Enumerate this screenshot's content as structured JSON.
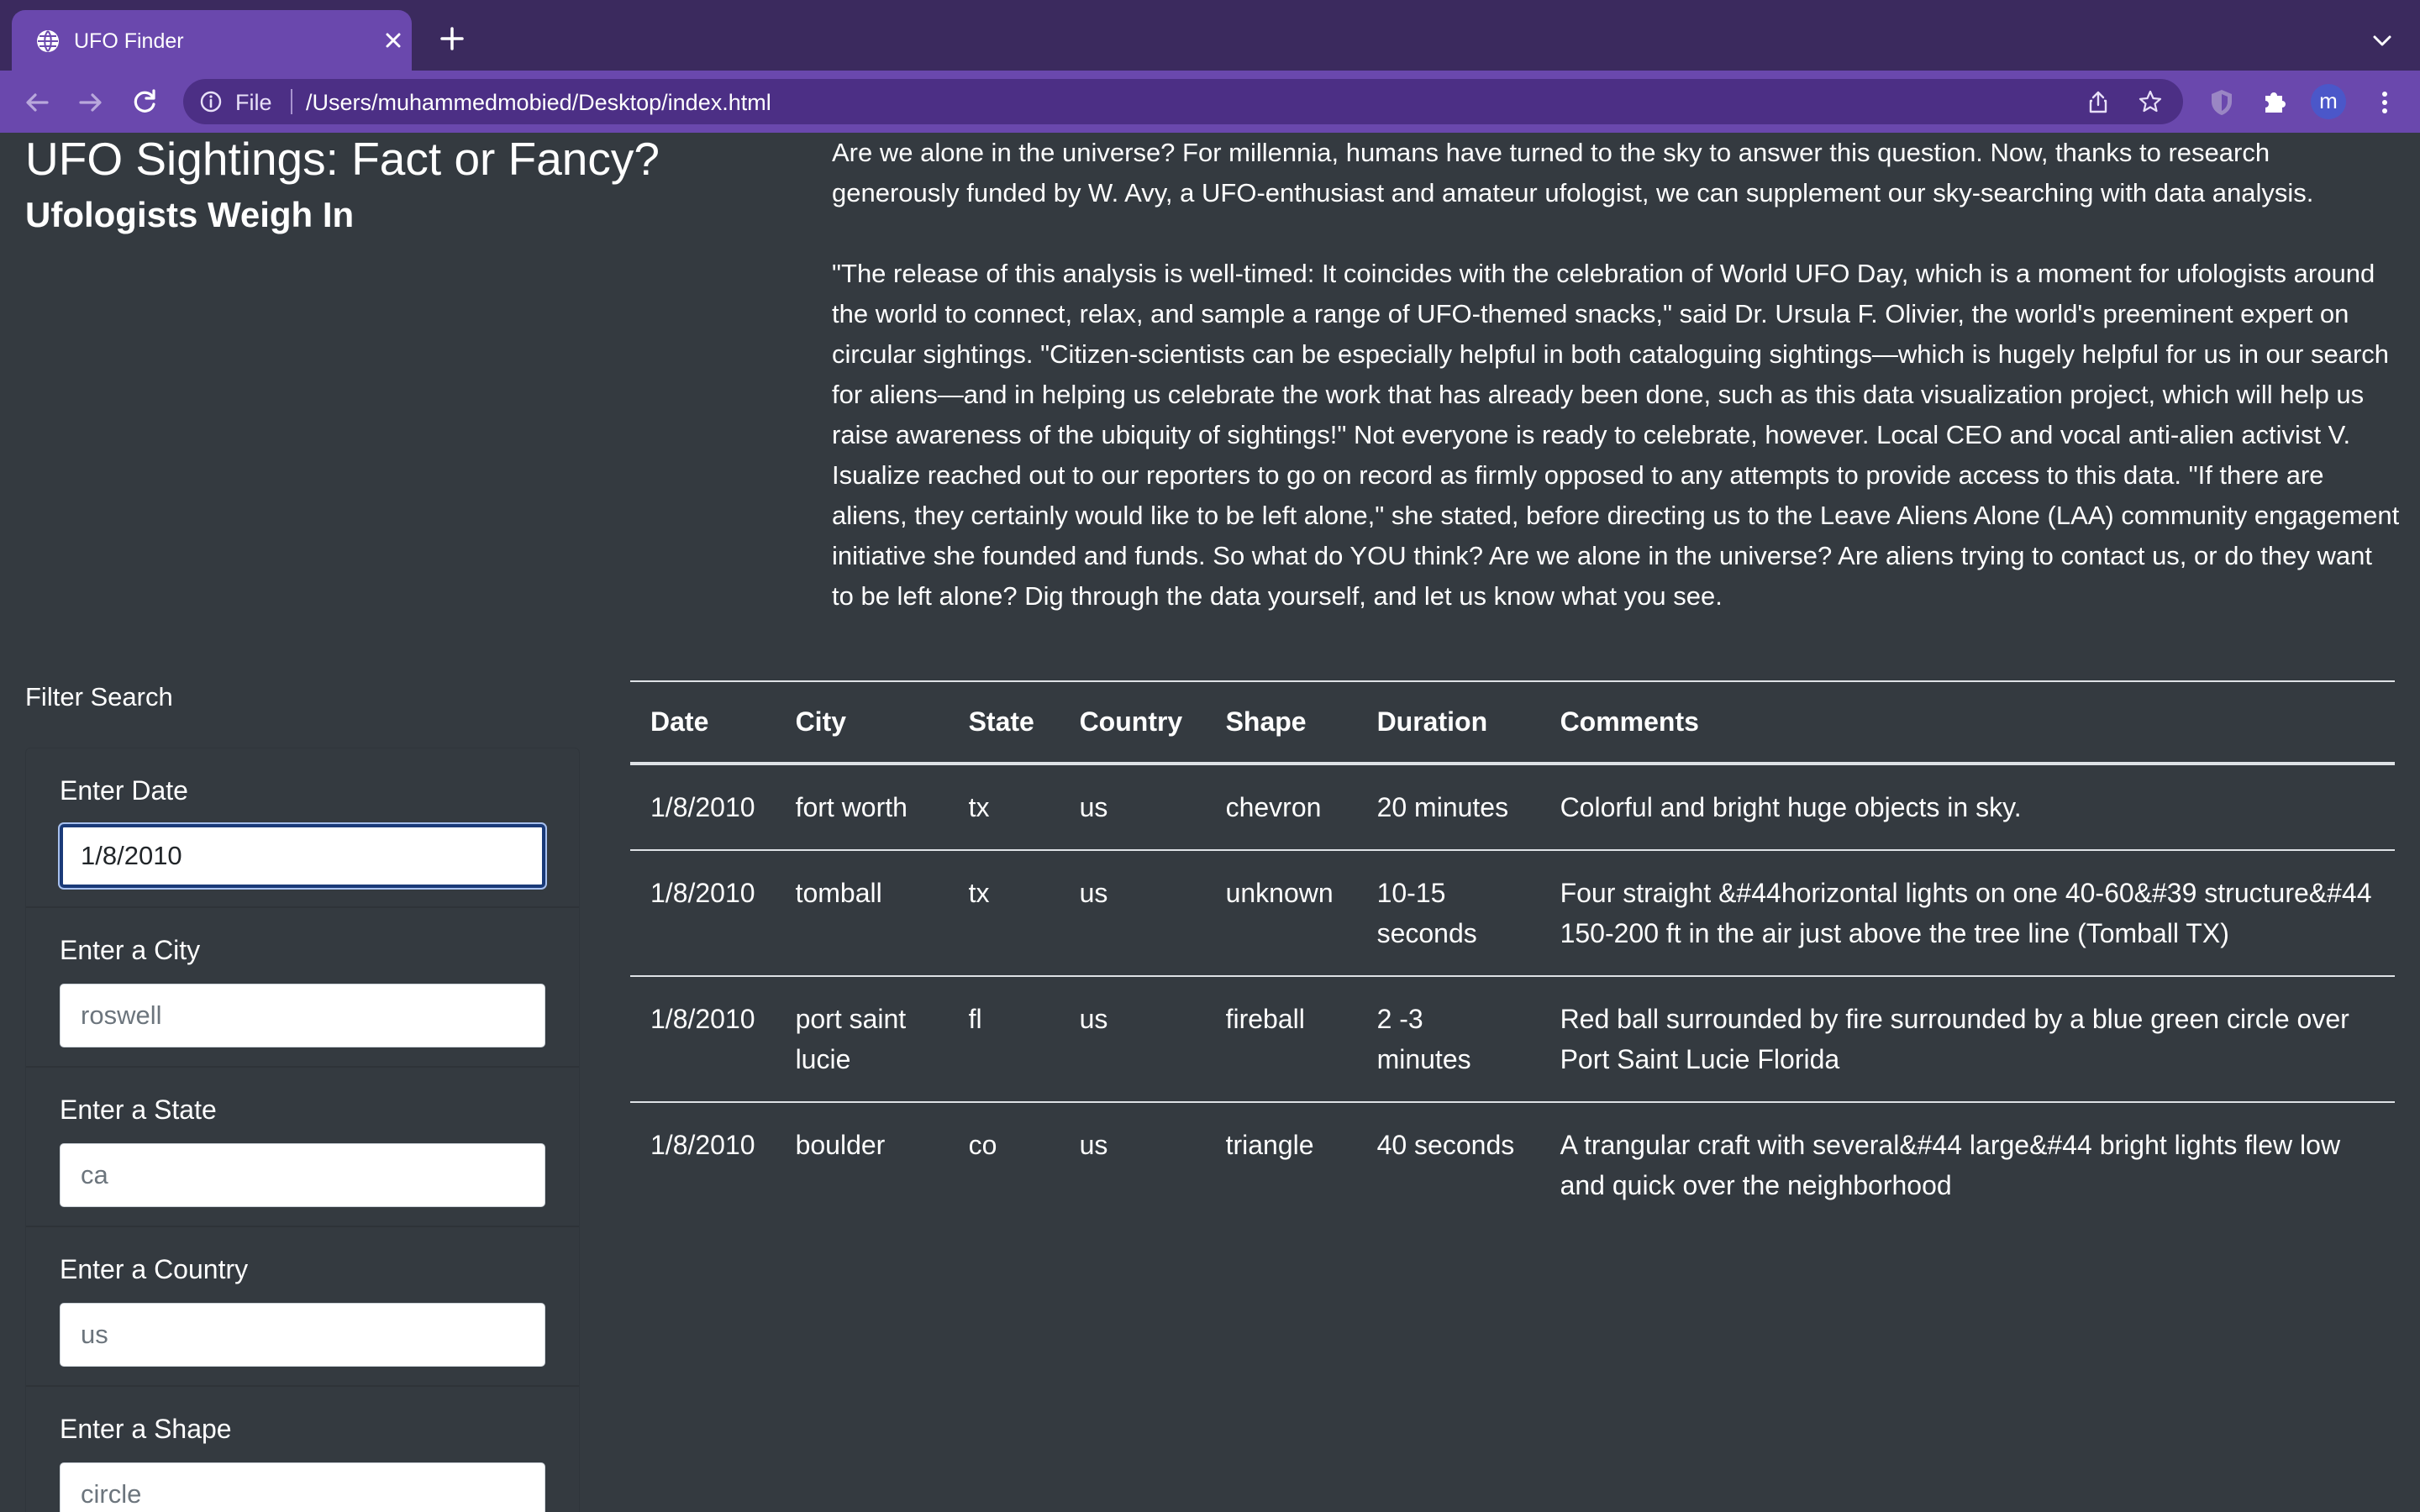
{
  "browser": {
    "tab_title": "UFO Finder",
    "omnibox_scheme": "File",
    "url": "/Users/muhammedmobied/Desktop/index.html",
    "profile_initial": "m",
    "accent_color": "#6a48ad"
  },
  "page": {
    "title": "UFO Sightings: Fact or Fancy?",
    "subtitle": "Ufologists Weigh In",
    "intro_paragraph_1": "Are we alone in the universe? For millennia, humans have turned to the sky to answer this question. Now, thanks to research generously funded by W. Avy, a UFO-enthusiast and amateur ufologist, we can supplement our sky-searching with data analysis.",
    "intro_paragraph_2": "\"The release of this analysis is well-timed: It coincides with the celebration of World UFO Day, which is a moment for ufologists around the world to connect, relax, and sample a range of UFO-themed snacks,\" said Dr. Ursula F. Olivier, the world's preeminent expert on circular sightings. \"Citizen-scientists can be especially helpful in both cataloguing sightings—which is hugely helpful for us in our search for aliens—and in helping us celebrate the work that has already been done, such as this data visualization project, which will help us raise awareness of the ubiquity of sightings!\" Not everyone is ready to celebrate, however. Local CEO and vocal anti-alien activist V. Isualize reached out to our reporters to go on record as firmly opposed to any attempts to provide access to this data. \"If there are aliens, they certainly would like to be left alone,\" she stated, before directing us to the Leave Aliens Alone (LAA) community engagement initiative she founded and funds. So what do YOU think? Are we alone in the universe? Are aliens trying to contact us, or do they want to be left alone? Dig through the data yourself, and let us know what you see."
  },
  "filters": {
    "heading": "Filter Search",
    "date": {
      "label": "Enter Date",
      "value": "1/8/2010",
      "placeholder": ""
    },
    "city": {
      "label": "Enter a City",
      "value": "",
      "placeholder": "roswell"
    },
    "state": {
      "label": "Enter a State",
      "value": "",
      "placeholder": "ca"
    },
    "country": {
      "label": "Enter a Country",
      "value": "",
      "placeholder": "us"
    },
    "shape": {
      "label": "Enter a Shape",
      "value": "",
      "placeholder": "circle"
    }
  },
  "table": {
    "headers": [
      "Date",
      "City",
      "State",
      "Country",
      "Shape",
      "Duration",
      "Comments"
    ],
    "rows": [
      [
        "1/8/2010",
        "fort worth",
        "tx",
        "us",
        "chevron",
        "20 minutes",
        "Colorful and bright huge objects in sky."
      ],
      [
        "1/8/2010",
        "tomball",
        "tx",
        "us",
        "unknown",
        "10-15 seconds",
        "Four straight &#44horizontal lights on one 40-60&#39 structure&#44 150-200 ft in the air just above the tree line (Tomball TX)"
      ],
      [
        "1/8/2010",
        "port saint lucie",
        "fl",
        "us",
        "fireball",
        "2 -3 minutes",
        "Red ball surrounded by fire surrounded by a blue green circle over Port Saint Lucie Florida"
      ],
      [
        "1/8/2010",
        "boulder",
        "co",
        "us",
        "triangle",
        "40 seconds",
        "A trangular craft with several&#44 large&#44 bright lights flew low and quick over the neighborhood"
      ]
    ]
  }
}
